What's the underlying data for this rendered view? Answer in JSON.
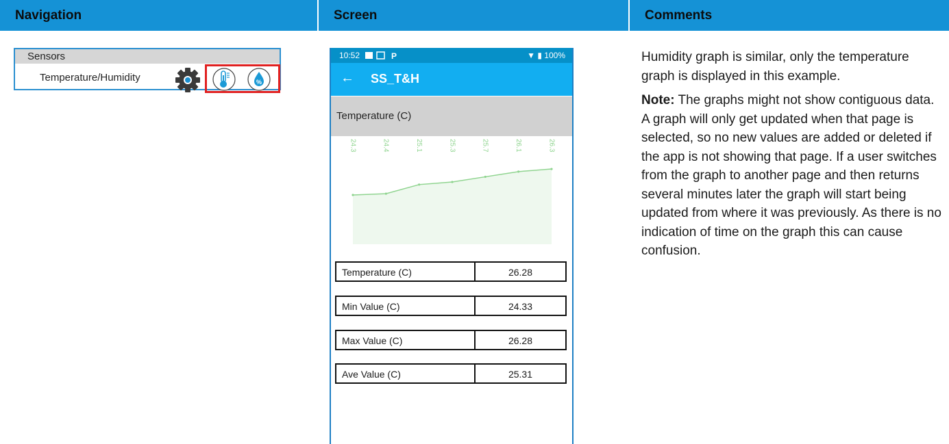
{
  "header": {
    "navigation": "Navigation",
    "screen": "Screen",
    "comments": "Comments"
  },
  "nav_card": {
    "title": "Sensors",
    "item_label": "Temperature/Humidity",
    "icons": [
      "gear-icon",
      "thermometer-icon",
      "humidity-percent-icon"
    ]
  },
  "phone": {
    "status_time": "10:52",
    "status_battery": "100%",
    "app_title": "SS_T&H",
    "section_title": "Temperature (C)",
    "rows": [
      {
        "label": "Temperature (C)",
        "value": "26.28"
      },
      {
        "label": "Min Value (C)",
        "value": "24.33"
      },
      {
        "label": "Max Value (C)",
        "value": "26.28"
      },
      {
        "label": "Ave Value (C)",
        "value": "25.31"
      }
    ]
  },
  "chart_data": {
    "type": "area",
    "point_labels": [
      "24.3",
      "24.4",
      "25.1",
      "25.3",
      "25.7",
      "26.1",
      "26.3"
    ],
    "values": [
      24.3,
      24.4,
      25.1,
      25.3,
      25.7,
      26.1,
      26.3
    ],
    "line_color": "#8fd48f",
    "fill_color": "#eef8ee"
  },
  "comments": {
    "p1": "Humidity graph is similar, only the temperature graph is displayed in this example.",
    "note_label": "Note:",
    "note_text": " The graphs might not show contiguous data. A graph will only get updated when that page is selected, so no new values are added or deleted if the app is not showing that page. If a user switches from the graph to another page and then returns several minutes later the graph will start being updated from where it was previously. As there is no indication of time on the graph this can cause confusion."
  }
}
